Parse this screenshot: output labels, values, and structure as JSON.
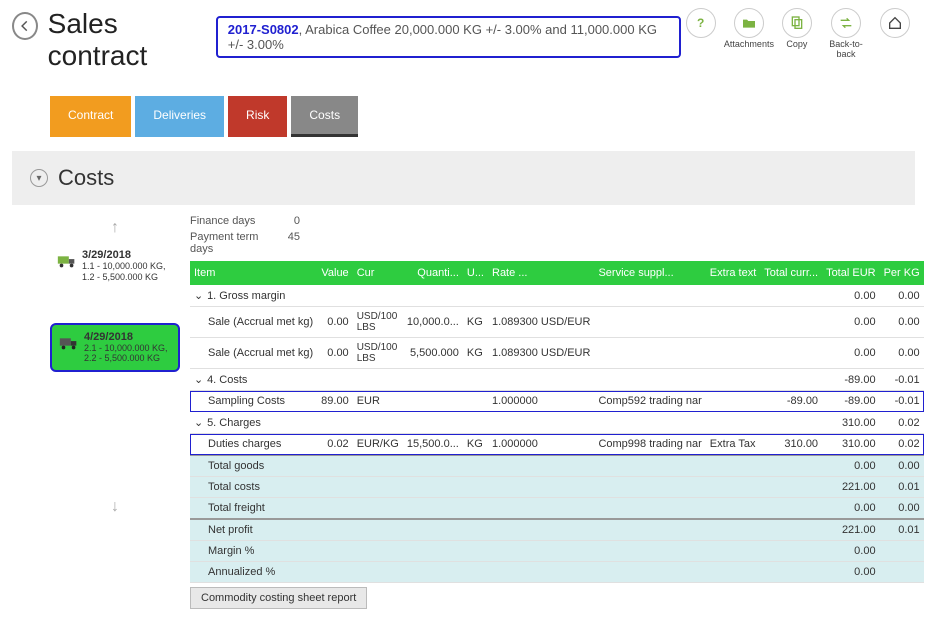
{
  "header": {
    "title": "Sales contract",
    "contract_id": "2017-S0802",
    "contract_desc": ", Arabica Coffee 20,000.000 KG +/- 3.00% and 11,000.000 KG +/- 3.00%"
  },
  "actions": {
    "help": "",
    "attachments": "Attachments",
    "copy": "Copy",
    "back_to_back": "Back-to-back"
  },
  "tabs": {
    "contract": "Contract",
    "deliveries": "Deliveries",
    "risk": "Risk",
    "costs": "Costs"
  },
  "section_title": "Costs",
  "meta": {
    "finance_days_label": "Finance days",
    "finance_days": "0",
    "payment_term_label": "Payment term days",
    "payment_term": "45"
  },
  "deliveries": [
    {
      "date": "3/29/2018",
      "lines": "1.1 - 10,000.000 KG, 1.2 - 5,500.000 KG"
    },
    {
      "date": "4/29/2018",
      "lines": "2.1 - 10,000.000 KG, 2.2 - 5,500.000 KG"
    }
  ],
  "columns": {
    "item": "Item",
    "value": "Value",
    "cur": "Cur",
    "qty": "Quanti...",
    "uom": "U...",
    "rate": "Rate ...",
    "supplier": "Service suppl...",
    "extra": "Extra text",
    "total_curr": "Total curr...",
    "total_eur": "Total EUR",
    "per_kg": "Per KG"
  },
  "groups": {
    "g1": "1. Gross margin",
    "g4": "4. Costs",
    "g5": "5. Charges"
  },
  "rows": {
    "gm": {
      "total_eur": "0.00",
      "per_kg": "0.00"
    },
    "sale1": {
      "item": "Sale (Accrual met kg)",
      "value": "0.00",
      "cur": "USD/100 LBS",
      "qty": "10,000.0...",
      "uom": "KG",
      "rate": "1.089300 USD/EUR",
      "total_eur": "0.00",
      "per_kg": "0.00"
    },
    "sale2": {
      "item": "Sale (Accrual met kg)",
      "value": "0.00",
      "cur": "USD/100 LBS",
      "qty": "5,500.000",
      "uom": "KG",
      "rate": "1.089300 USD/EUR",
      "total_eur": "0.00",
      "per_kg": "0.00"
    },
    "costs_group": {
      "total_eur": "-89.00",
      "per_kg": "-0.01"
    },
    "sampling": {
      "item": "Sampling Costs",
      "value": "89.00",
      "cur": "EUR",
      "rate": "1.000000",
      "supplier": "Comp592 trading nar",
      "total_curr": "-89.00",
      "total_eur": "-89.00",
      "per_kg": "-0.01"
    },
    "charges_group": {
      "total_eur": "310.00",
      "per_kg": "0.02"
    },
    "duties": {
      "item": "Duties charges",
      "value": "0.02",
      "cur": "EUR/KG",
      "qty": "15,500.0...",
      "uom": "KG",
      "rate": "1.000000",
      "supplier": "Comp998 trading nar",
      "extra": "Extra Tax",
      "total_curr": "310.00",
      "total_eur": "310.00",
      "per_kg": "0.02"
    }
  },
  "summary": {
    "total_goods": {
      "label": "Total goods",
      "eur": "0.00",
      "kg": "0.00"
    },
    "total_costs": {
      "label": "Total costs",
      "eur": "221.00",
      "kg": "0.01"
    },
    "total_freight": {
      "label": "Total freight",
      "eur": "0.00",
      "kg": "0.00"
    },
    "net_profit": {
      "label": "Net profit",
      "eur": "221.00",
      "kg": "0.01"
    },
    "margin": {
      "label": "Margin %",
      "eur": "0.00",
      "kg": ""
    },
    "annualized": {
      "label": "Annualized %",
      "eur": "0.00",
      "kg": ""
    }
  },
  "footer_button": "Commodity costing sheet report"
}
